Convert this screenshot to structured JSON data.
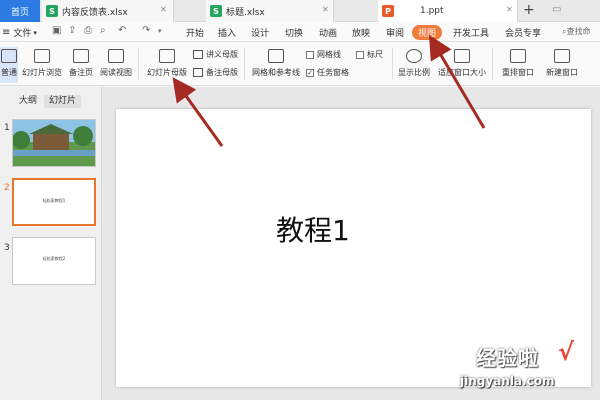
{
  "tabs": {
    "home": "首页",
    "doc1": "内容反馈表.xlsx",
    "doc2": "标题.xlsx",
    "doc3": "1.ppt",
    "add": "+"
  },
  "menu": {
    "file": "文件",
    "start": "开始",
    "insert": "插入",
    "design": "设计",
    "transition": "切换",
    "animation": "动画",
    "slideshow": "放映",
    "review": "审阅",
    "view": "视图",
    "devtools": "开发工具",
    "member": "会员专享",
    "search": "查找命"
  },
  "ribbon": {
    "normal": "普通",
    "sorter": "幻灯片浏览",
    "notes_page": "备注页",
    "reading": "阅读视图",
    "slide_master": "幻灯片母版",
    "handout_master": "讲义母版",
    "notes_master": "备注母版",
    "grid_guides": "网格和参考线",
    "gridlines": "网格线",
    "ruler": "标尺",
    "task_pane": "任务窗格",
    "zoom": "显示比例",
    "fit_window": "适应窗口大小",
    "arrange": "重排窗口",
    "new_window": "新建窗口"
  },
  "pane": {
    "outline": "大纲",
    "slides": "幻灯片"
  },
  "slides": [
    {
      "num": "1",
      "text": ""
    },
    {
      "num": "2",
      "text": "轻松家教程1"
    },
    {
      "num": "3",
      "text": "轻松家教程2"
    }
  ],
  "canvas": {
    "title": "教程1"
  },
  "watermark": {
    "title": "经验啦",
    "check": "√",
    "url": "jingyanla.com"
  },
  "colors": {
    "accent": "#2b7be3",
    "highlight": "#f07a3a",
    "arrow": "#a52a22"
  }
}
